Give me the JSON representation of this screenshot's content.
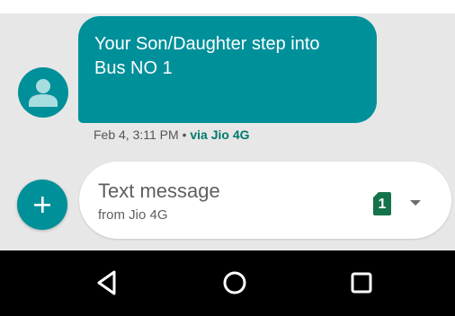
{
  "conversation": {
    "message": {
      "text_line1": "Your Son/Daughter step into",
      "text_line2": "Bus NO 1",
      "timestamp": "Feb 4, 3:11 PM",
      "separator": " • ",
      "via": "via Jio 4G"
    },
    "avatar_icon": "person-icon"
  },
  "compose": {
    "add_icon": "plus-icon",
    "placeholder": "Text message",
    "subtext": "from Jio 4G",
    "sim_number": "1",
    "dropdown_icon": "caret-down-icon"
  },
  "navbar": {
    "back_icon": "back-triangle-icon",
    "home_icon": "home-circle-icon",
    "recents_icon": "recents-square-icon"
  },
  "colors": {
    "accent": "#00909a",
    "background": "#e7e7e7",
    "sim_badge": "#14734a",
    "via_text": "#00796b",
    "navbar": "#000000"
  }
}
